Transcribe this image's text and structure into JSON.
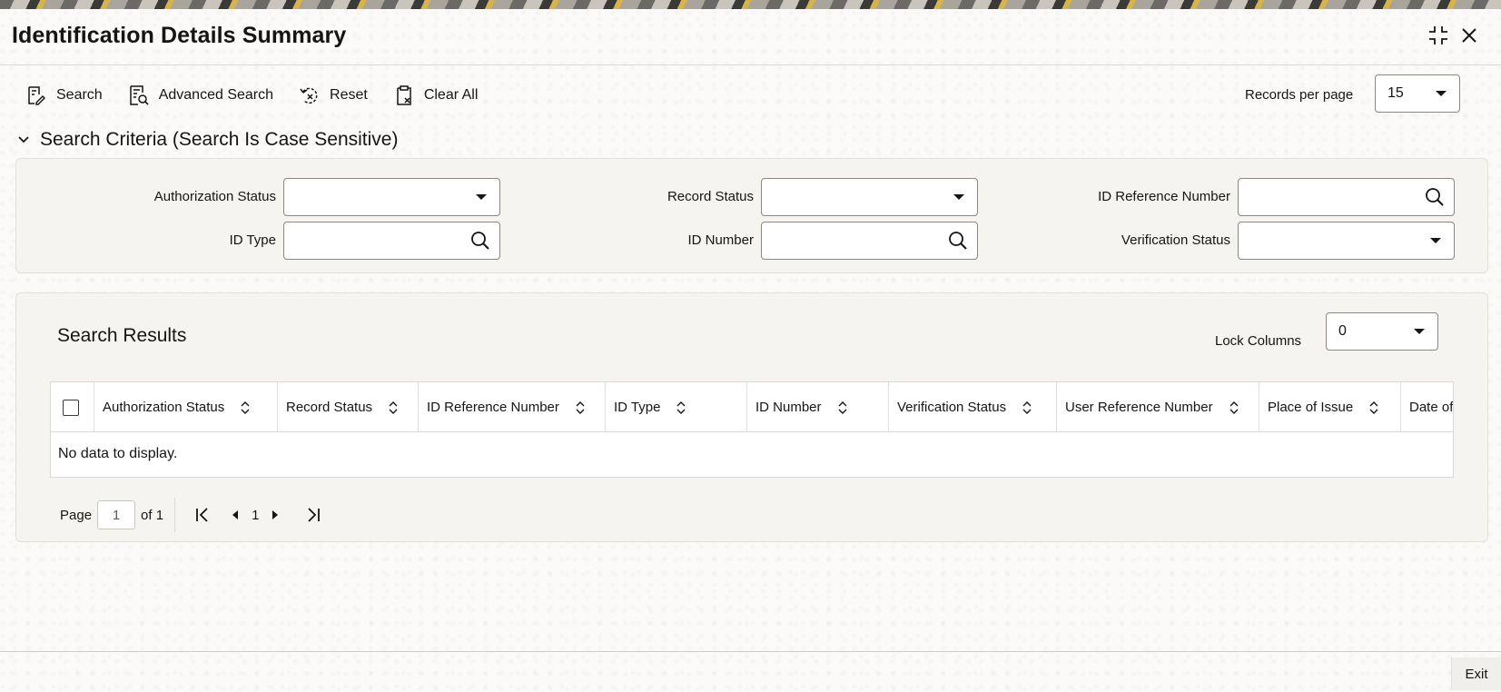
{
  "window": {
    "title": "Identification Details Summary"
  },
  "toolbar": {
    "search_label": "Search",
    "advanced_search_label": "Advanced Search",
    "reset_label": "Reset",
    "clear_all_label": "Clear All"
  },
  "records_per_page": {
    "label": "Records per page",
    "value": "15"
  },
  "search_criteria": {
    "header": "Search Criteria (Search Is Case Sensitive)",
    "fields": {
      "authorization_status": {
        "label": "Authorization Status",
        "value": ""
      },
      "record_status": {
        "label": "Record Status",
        "value": ""
      },
      "id_reference_number": {
        "label": "ID Reference Number",
        "value": ""
      },
      "id_type": {
        "label": "ID Type",
        "value": ""
      },
      "id_number": {
        "label": "ID Number",
        "value": ""
      },
      "verification_status": {
        "label": "Verification Status",
        "value": ""
      }
    }
  },
  "search_results": {
    "title": "Search Results",
    "lock_columns": {
      "label": "Lock Columns",
      "value": "0"
    },
    "columns": [
      "Authorization Status",
      "Record Status",
      "ID Reference Number",
      "ID Type",
      "ID Number",
      "Verification Status",
      "User Reference Number",
      "Place of Issue",
      "Date of"
    ],
    "no_data_text": "No data to display."
  },
  "pagination": {
    "page_label": "Page",
    "current_page": "1",
    "of_label": "of 1",
    "page_number": "1"
  },
  "footer": {
    "exit_label": "Exit"
  }
}
